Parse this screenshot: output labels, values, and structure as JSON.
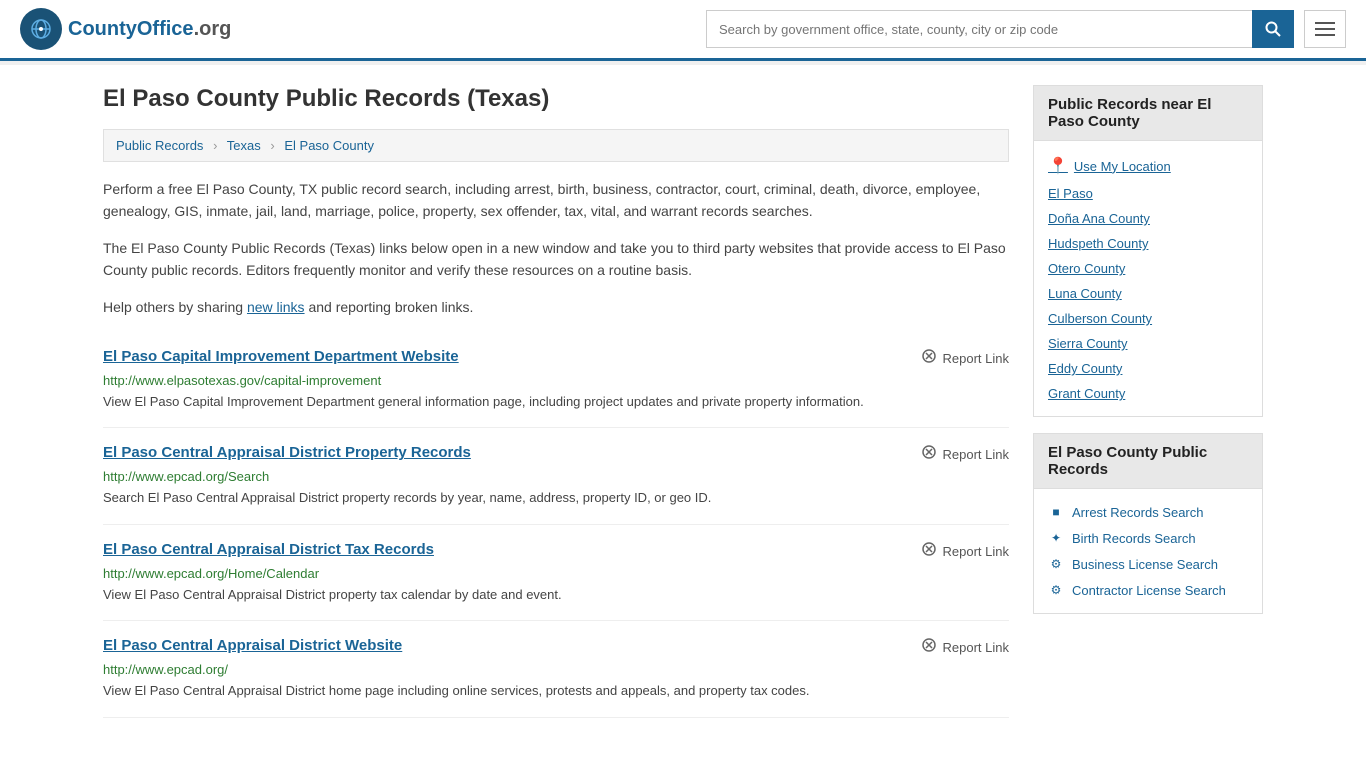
{
  "header": {
    "logo_text_main": "CountyOffice",
    "logo_text_ext": ".org",
    "search_placeholder": "Search by government office, state, county, city or zip code",
    "search_value": ""
  },
  "page": {
    "title": "El Paso County Public Records (Texas)",
    "breadcrumbs": [
      {
        "label": "Public Records",
        "href": "#"
      },
      {
        "label": "Texas",
        "href": "#"
      },
      {
        "label": "El Paso County",
        "href": "#"
      }
    ],
    "description1": "Perform a free El Paso County, TX public record search, including arrest, birth, business, contractor, court, criminal, death, divorce, employee, genealogy, GIS, inmate, jail, land, marriage, police, property, sex offender, tax, vital, and warrant records searches.",
    "description2": "The El Paso County Public Records (Texas) links below open in a new window and take you to third party websites that provide access to El Paso County public records. Editors frequently monitor and verify these resources on a routine basis.",
    "description3_pre": "Help others by sharing ",
    "description3_link": "new links",
    "description3_post": " and reporting broken links."
  },
  "records": [
    {
      "title": "El Paso Capital Improvement Department Website",
      "url": "http://www.elpasotexas.gov/capital-improvement",
      "desc": "View El Paso Capital Improvement Department general information page, including project updates and private property information."
    },
    {
      "title": "El Paso Central Appraisal District Property Records",
      "url": "http://www.epcad.org/Search",
      "desc": "Search El Paso Central Appraisal District property records by year, name, address, property ID, or geo ID."
    },
    {
      "title": "El Paso Central Appraisal District Tax Records",
      "url": "http://www.epcad.org/Home/Calendar",
      "desc": "View El Paso Central Appraisal District property tax calendar by date and event."
    },
    {
      "title": "El Paso Central Appraisal District Website",
      "url": "http://www.epcad.org/",
      "desc": "View El Paso Central Appraisal District home page including online services, protests and appeals, and property tax codes."
    }
  ],
  "report_label": "Report Link",
  "sidebar": {
    "nearby_title": "Public Records near El Paso County",
    "use_location": "Use My Location",
    "nearby_links": [
      "El Paso",
      "Doña Ana County",
      "Hudspeth County",
      "Otero County",
      "Luna County",
      "Culberson County",
      "Sierra County",
      "Eddy County",
      "Grant County"
    ],
    "records_title": "El Paso County Public Records",
    "record_links": [
      {
        "label": "Arrest Records Search",
        "icon": "■"
      },
      {
        "label": "Birth Records Search",
        "icon": "✦"
      },
      {
        "label": "Business License Search",
        "icon": "⚙"
      },
      {
        "label": "Contractor License Search",
        "icon": "⚙"
      }
    ]
  }
}
